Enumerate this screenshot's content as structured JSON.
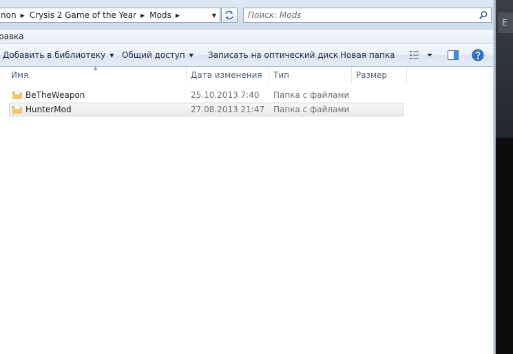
{
  "breadcrumbs": [
    {
      "label": "non"
    },
    {
      "label": "Crysis 2 Game of the Year"
    },
    {
      "label": "Mods"
    }
  ],
  "search": {
    "placeholder": "Поиск: Mods"
  },
  "menu": {
    "edit_label": "равка"
  },
  "commands": {
    "add_library": "Добавить в библиотеку",
    "share": "Общий доступ",
    "burn": "Записать на оптический диск",
    "new_folder": "Новая папка"
  },
  "columns": {
    "name": "Имя",
    "date": "Дата изменения",
    "type": "Тип",
    "size": "Размер"
  },
  "files": [
    {
      "name": "BeTheWeapon",
      "date": "25.10.2013 7:40",
      "type": "Папка с файлами",
      "size": ""
    },
    {
      "name": "HunterMod",
      "date": "27.08.2013 21:47",
      "type": "Папка с файлами",
      "size": ""
    }
  ],
  "background_window": {
    "tab_letter": "E"
  },
  "icons": {
    "crumb_separator": "chevron-right-icon",
    "address_dropdown": "chevron-down-icon",
    "refresh": "refresh-icon",
    "search": "search-icon",
    "view": "view-options-icon",
    "preview": "preview-pane-icon",
    "help": "help-icon",
    "folder": "folder-icon"
  },
  "colors": {
    "selection_bg": "#ebebeb",
    "header_text": "#4c607a",
    "help_blue": "#1f5fb8",
    "folder_yellow": "#e9c462"
  }
}
